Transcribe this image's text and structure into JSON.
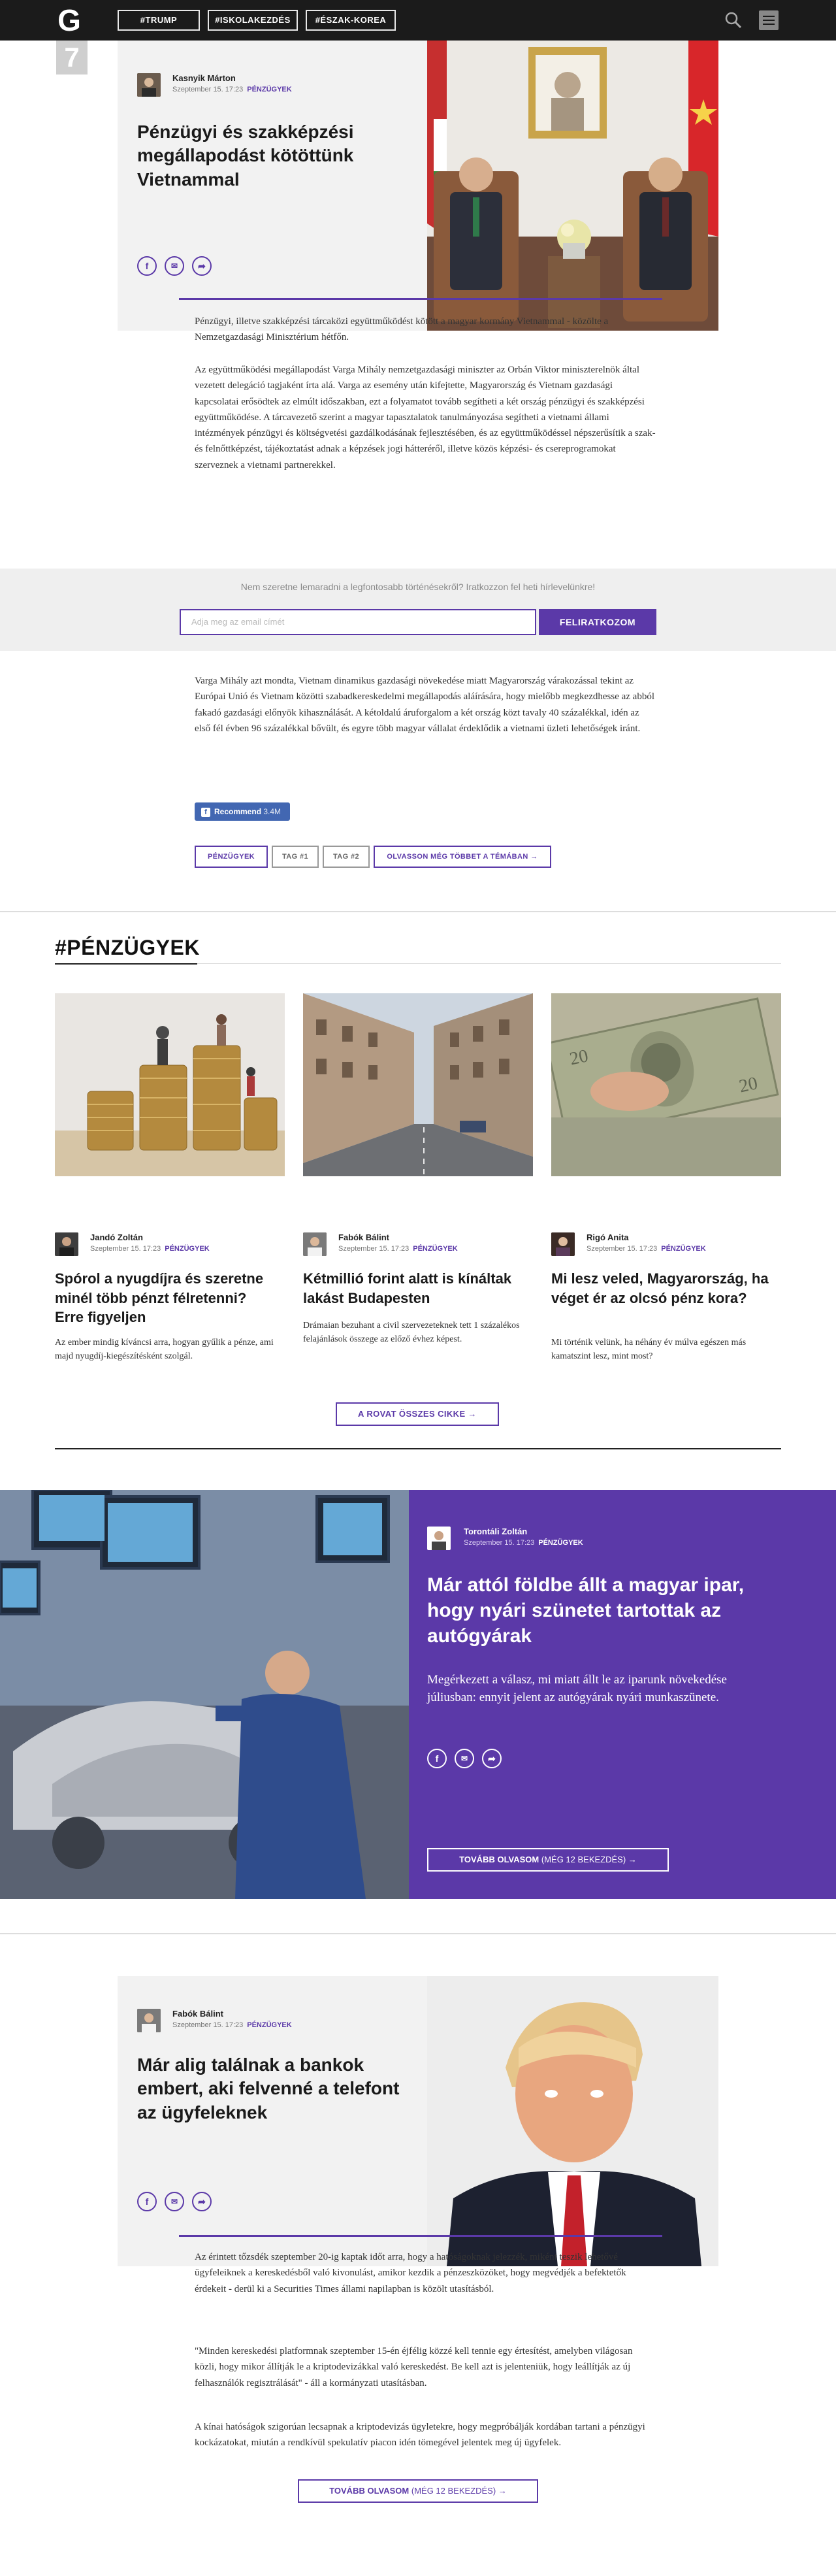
{
  "nav": {
    "logo": "G",
    "tags": [
      "#TRUMP",
      "#ISKOLAKEZDÉS",
      "#ÉSZAK-KOREA"
    ]
  },
  "article1": {
    "rank": "7",
    "author": "Kasnyik Márton",
    "date": "Szeptember 15. 17:23",
    "category": "PÉNZÜGYEK",
    "title": "Pénzügyi és szakképzési megállapodást kötöttünk Vietnammal",
    "paragraphs": [
      "Pénzügyi, illetve szakképzési tárcaközi együttműködést kötött a magyar kormány Vietnammal - közölte a Nemzetgazdasági Minisztérium hétfőn.",
      "Az együttműködési megállapodást Varga Mihály nemzetgazdasági miniszter az Orbán Viktor miniszterelnök által vezetett delegáció tagjaként írta alá. Varga az esemény után kifejtette, Magyarország és Vietnam gazdasági kapcsolatai erősödtek az elmúlt időszakban, ezt a folyamatot tovább segítheti a két ország pénzügyi és szakképzési együttműködése. A tárcavezető szerint a magyar tapasztalatok tanulmányozása segítheti a vietnami állami intézmények pénzügyi és költségvetési gazdálkodásának fejlesztésében, és az együttműködéssel népszerűsítik a szak- és felnőttképzést, tájékoztatást adnak a képzések jogi hátteréről, illetve közös képzési- és csereprogramokat szerveznek a vietnami partnerekkel.",
      "Varga Mihály azt mondta, Vietnam dinamikus gazdasági növekedése miatt Magyarország várakozással tekint az Európai Unió és Vietnam közötti szabadkereskedelmi megállapodás aláírására, hogy mielőbb megkezdhesse az abból fakadó gazdasági előnyök kihasználását. A kétoldalú áruforgalom a két ország közt tavaly 40 százalékkal, idén az első fél évben 96 százalékkal bővült, és egyre több magyar vállalat érdeklődik a vietnami üzleti lehetőségek iránt."
    ],
    "recommend_label": "Recommend",
    "recommend_count": "3.4M",
    "tags": [
      "PÉNZÜGYEK",
      "TAG #1",
      "TAG #2"
    ],
    "more_topic": "OLVASSON MÉG TÖBBET A TÉMÁBAN"
  },
  "newsletter": {
    "text": "Nem szeretne lemaradni a legfontosabb történésekről? Iratkozzon fel heti hírlevelünkre!",
    "placeholder": "Adja meg az email címét",
    "button": "FELIRATKOZOM"
  },
  "section": {
    "title": "#PÉNZÜGYEK",
    "all_button": "A ROVAT ÖSSZES CIKKE",
    "cards": [
      {
        "author": "Jandó Zoltán",
        "date": "Szeptember 15. 17:23",
        "category": "PÉNZÜGYEK",
        "title": "Spórol a nyugdíjra és szeretne minél több pénzt félretenni? Erre figyeljen",
        "lead": "Az ember mindig kíváncsi arra, hogyan gyűlik a pénze, ami majd nyugdíj-kiegészítésként szolgál."
      },
      {
        "author": "Fabók Bálint",
        "date": "Szeptember 15. 17:23",
        "category": "PÉNZÜGYEK",
        "title": "Kétmillió forint alatt is kínáltak lakást Budapesten",
        "lead": "Drámaian bezuhant a civil szervezeteknek tett 1 százalékos felajánlások összege az előző évhez képest."
      },
      {
        "author": "Rigó Anita",
        "date": "Szeptember 15. 17:23",
        "category": "PÉNZÜGYEK",
        "title": "Mi lesz veled, Magyarország, ha véget ér az olcsó pénz kora?",
        "lead": "Mi történik velünk, ha néhány év múlva egészen más kamatszint lesz, mint most?"
      }
    ]
  },
  "feature": {
    "author": "Torontáli Zoltán",
    "date": "Szeptember 15. 17:23",
    "category": "PÉNZÜGYEK",
    "title": "Már attól földbe állt a magyar ipar, hogy nyári szünetet tartottak az autógyárak",
    "lead": "Megérkezett a válasz, mi miatt állt le az iparunk növekedése júliusban: ennyit jelent az autógyárak nyári munkaszünete.",
    "more": "TOVÁBB OLVASOM",
    "more_count": "(MÉG 12 BEKEZDÉS)"
  },
  "article2": {
    "author": "Fabók Bálint",
    "date": "Szeptember 15. 17:23",
    "category": "PÉNZÜGYEK",
    "title": "Már alig találnak a bankok embert, aki felvenné a telefont az ügyfeleknek",
    "paragraphs": [
      "Az érintett tőzsdék szeptember 20-ig kaptak időt arra, hogy a hatóságoknak jelezzék, miként teszik lehetővé ügyfeleiknek a kereskedésből való kivonulást, amikor kezdik a pénzeszközöket, hogy megvédjék a befektetők érdekeit - derül ki a Securities Times állami napilapban is közölt utasításból.",
      "\"Minden kereskedési platformnak szeptember 15-én éjfélig közzé kell tennie egy értesítést, amelyben világosan közli, hogy mikor állítják le a kriptodevizákkal való kereskedést. Be kell azt is jelenteniük, hogy leállítják az új felhasználók regisztrálását\" - áll a kormányzati utasításban.",
      "A kínai hatóságok szigorúan lecsapnak a kriptodevizás ügyletekre, hogy megpróbálják kordában tartani a pénzügyi kockázatokat, miután a rendkívül spekulatív piacon idén tömegével jelentek meg új ügyfelek."
    ],
    "more": "TOVÁBB OLVASOM",
    "more_count": "(MÉG 12 BEKEZDÉS)"
  },
  "icons": {
    "facebook": "facebook-icon",
    "email": "email-icon",
    "share": "share-icon",
    "search": "search-icon",
    "menu": "menu-icon",
    "arrow": "arrow-right-icon"
  },
  "colors": {
    "accent": "#5b39a8",
    "nav": "#1b1b1b",
    "facebook": "#4267b2"
  }
}
